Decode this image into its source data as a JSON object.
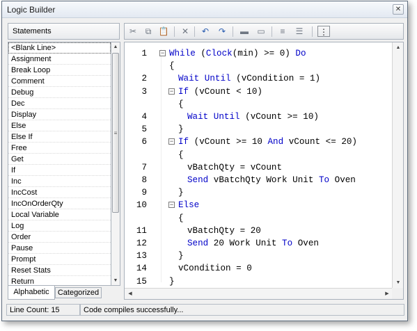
{
  "window": {
    "title": "Logic Builder",
    "close_glyph": "✕"
  },
  "statements": {
    "header": "Statements",
    "items": [
      "<Blank Line>",
      "Assignment",
      "Break Loop",
      "Comment",
      "Debug",
      "Dec",
      "Display",
      "Else",
      "Else If",
      "Free",
      "Get",
      "If",
      "Inc",
      "IncCost",
      "IncOnOrderQty",
      "Local Variable",
      "Log",
      "Order",
      "Pause",
      "Prompt",
      "Reset Stats",
      "Return"
    ],
    "selected_index": 0
  },
  "tabs": [
    {
      "label": "Alphabetic",
      "active": true
    },
    {
      "label": "Categorized",
      "active": false
    }
  ],
  "toolbar": [
    {
      "name": "cut-icon",
      "glyph": "✂"
    },
    {
      "name": "copy-icon",
      "glyph": "⧉"
    },
    {
      "name": "paste-icon",
      "glyph": "📋"
    },
    {
      "name": "delete-icon",
      "glyph": "✕"
    },
    {
      "name": "undo-icon",
      "glyph": "↶"
    },
    {
      "name": "redo-icon",
      "glyph": "↷"
    },
    {
      "name": "block-comment-icon",
      "glyph": "▬"
    },
    {
      "name": "uncomment-icon",
      "glyph": "▭"
    },
    {
      "name": "indent-icon",
      "glyph": "≡"
    },
    {
      "name": "outdent-icon",
      "glyph": "☰"
    },
    {
      "name": "line-numbers-icon",
      "glyph": "⋮"
    }
  ],
  "code": [
    {
      "num": "1",
      "fold": true,
      "indent": 0,
      "segs": [
        [
          "kw",
          "While "
        ],
        [
          "",
          "("
        ],
        [
          "kw",
          "Clock"
        ],
        [
          "",
          "(min) >= 0) "
        ],
        [
          "kw",
          "Do"
        ]
      ]
    },
    {
      "num": "",
      "fold": false,
      "indent": 0,
      "segs": [
        [
          "",
          "{"
        ]
      ]
    },
    {
      "num": "2",
      "fold": false,
      "indent": 1,
      "segs": [
        [
          "kw",
          "Wait Until"
        ],
        [
          "",
          " (vCondition = 1)"
        ]
      ]
    },
    {
      "num": "3",
      "fold": true,
      "indent": 1,
      "segs": [
        [
          "kw",
          "If"
        ],
        [
          "",
          " (vCount < 10)"
        ]
      ]
    },
    {
      "num": "",
      "fold": false,
      "indent": 1,
      "segs": [
        [
          "",
          "{"
        ]
      ]
    },
    {
      "num": "4",
      "fold": false,
      "indent": 2,
      "segs": [
        [
          "kw",
          "Wait Until"
        ],
        [
          "",
          " (vCount >= 10)"
        ]
      ]
    },
    {
      "num": "5",
      "fold": false,
      "indent": 1,
      "segs": [
        [
          "",
          "}"
        ]
      ]
    },
    {
      "num": "6",
      "fold": true,
      "indent": 1,
      "segs": [
        [
          "kw",
          "If"
        ],
        [
          "",
          " (vCount >= 10 "
        ],
        [
          "kw",
          "And"
        ],
        [
          "",
          " vCount <= 20)"
        ]
      ]
    },
    {
      "num": "",
      "fold": false,
      "indent": 1,
      "segs": [
        [
          "",
          "{"
        ]
      ]
    },
    {
      "num": "7",
      "fold": false,
      "indent": 2,
      "segs": [
        [
          "",
          "vBatchQty = vCount"
        ]
      ]
    },
    {
      "num": "8",
      "fold": false,
      "indent": 2,
      "segs": [
        [
          "kw",
          "Send"
        ],
        [
          "",
          " vBatchQty Work Unit "
        ],
        [
          "kw",
          "To"
        ],
        [
          "",
          " Oven"
        ]
      ]
    },
    {
      "num": "9",
      "fold": false,
      "indent": 1,
      "segs": [
        [
          "",
          "}"
        ]
      ]
    },
    {
      "num": "10",
      "fold": true,
      "indent": 1,
      "segs": [
        [
          "kw",
          "Else"
        ]
      ]
    },
    {
      "num": "",
      "fold": false,
      "indent": 1,
      "segs": [
        [
          "",
          "{"
        ]
      ]
    },
    {
      "num": "11",
      "fold": false,
      "indent": 2,
      "segs": [
        [
          "",
          "vBatchQty = 20"
        ]
      ]
    },
    {
      "num": "12",
      "fold": false,
      "indent": 2,
      "segs": [
        [
          "kw",
          "Send"
        ],
        [
          "",
          " 20 Work Unit "
        ],
        [
          "kw",
          "To"
        ],
        [
          "",
          " Oven"
        ]
      ]
    },
    {
      "num": "13",
      "fold": false,
      "indent": 1,
      "segs": [
        [
          "",
          "}"
        ]
      ]
    },
    {
      "num": "14",
      "fold": false,
      "indent": 1,
      "segs": [
        [
          "",
          "vCondition = 0"
        ]
      ]
    },
    {
      "num": "15",
      "fold": false,
      "indent": 0,
      "segs": [
        [
          "",
          "}"
        ]
      ]
    }
  ],
  "status": {
    "line_count": "Line Count: 15",
    "message": "Code compiles successfully..."
  },
  "colors": {
    "keyword": "#0000c8",
    "text": "#000000"
  }
}
